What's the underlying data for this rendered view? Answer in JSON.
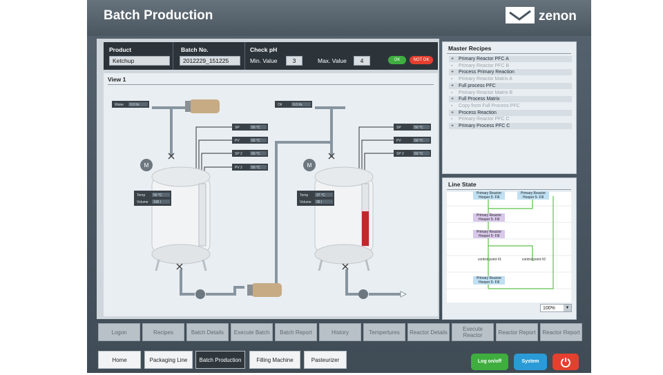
{
  "header": {
    "title": "Batch Production",
    "logo_text": "zenon"
  },
  "topbar": {
    "product_label": "Product",
    "product_value": "Ketchup",
    "batch_label": "Batch No.",
    "batch_value": "2012229_151225",
    "check_label": "Check pH",
    "min_label": "Min. Value",
    "min_value": "3",
    "max_label": "Max. Value",
    "max_value": "4",
    "ok_label": "OK",
    "notok_label": "NOT OK"
  },
  "view": {
    "title": "View 1",
    "water_label": "Water",
    "water_value": "0.0 l/s",
    "oil_label": "Oil",
    "oil_value": "0.0 l/s",
    "tank1": {
      "sp": "SP",
      "sp_value": "50 °C",
      "pv": "PV",
      "pv_value": "50 °C",
      "sp2": "SP 2",
      "sp2_value": "50 °C",
      "pv2": "PV 2",
      "pv2_value": "50 °C",
      "temp_label": "Temp",
      "temp_value": "50 °C",
      "volume_label": "Volume",
      "volume_value": "100 l",
      "level": 0.0
    },
    "tank2": {
      "sp": "SP",
      "sp_value": "50 °C",
      "pv": "PV",
      "pv_value": "50 °C",
      "sp2": "SP 2",
      "sp2_value": "50 °C",
      "temp_label": "Temp",
      "temp_value": "37 °C",
      "volume_label": "Volume",
      "volume_value": "26 l",
      "level": 0.55
    },
    "motor_label": "M"
  },
  "master_recipes": {
    "title": "Master Recipes",
    "items": [
      {
        "label": "Primary Reactor PFC A",
        "active": true
      },
      {
        "label": "Primary Reactor PFC B",
        "active": false
      },
      {
        "label": "Process Primary Reaction",
        "active": true
      },
      {
        "label": "Primary Reactor Matrix A",
        "active": false
      },
      {
        "label": "Full process PFC",
        "active": true
      },
      {
        "label": "Primary Reactor Matrix B",
        "active": false
      },
      {
        "label": "Full Process Matrix",
        "active": true
      },
      {
        "label": "Copy from Full Process PFC",
        "active": false
      },
      {
        "label": "Process Reaction",
        "active": true
      },
      {
        "label": "Primary Reactor PFC C",
        "active": false
      },
      {
        "label": "Primary Process PFC C",
        "active": true
      }
    ]
  },
  "line_state": {
    "title": "Line State",
    "nodes": [
      {
        "line1": "Primary Reactor",
        "line2": "Hooper 5- Fill"
      },
      {
        "line1": "Primary Reactor",
        "line2": "Hooper 5- Fill"
      },
      {
        "line1": "Primary Reactor",
        "line2": "Hooper 5- Fill"
      },
      {
        "line1": "Primary Reactor",
        "line2": "Hooper 5- Fill"
      },
      {
        "line1": "Primary Reactor",
        "line2": "Hooper 5- Fill"
      }
    ],
    "control1": "control point #1",
    "control2": "control point #2",
    "zoom": "100%"
  },
  "nav1": [
    "Logon",
    "Recipes",
    "Batch Details",
    "Execute Batch",
    "Batch Report",
    "History",
    "Tempertures",
    "Reactor Details",
    "Execute Reactor",
    "Reactor Report",
    "Reactor Report"
  ],
  "nav2": [
    {
      "label": "Home",
      "active": false
    },
    {
      "label": "Packaging Line",
      "active": false
    },
    {
      "label": "Batch Production",
      "active": true
    },
    {
      "label": "Filling Machine",
      "active": false
    },
    {
      "label": "Pasteurizer",
      "active": false
    }
  ],
  "actions": {
    "logon": "Log on/off",
    "system": "System",
    "logon_color": "#3fae3f",
    "system_color": "#2a9bd6",
    "power_color": "#e4402f"
  }
}
